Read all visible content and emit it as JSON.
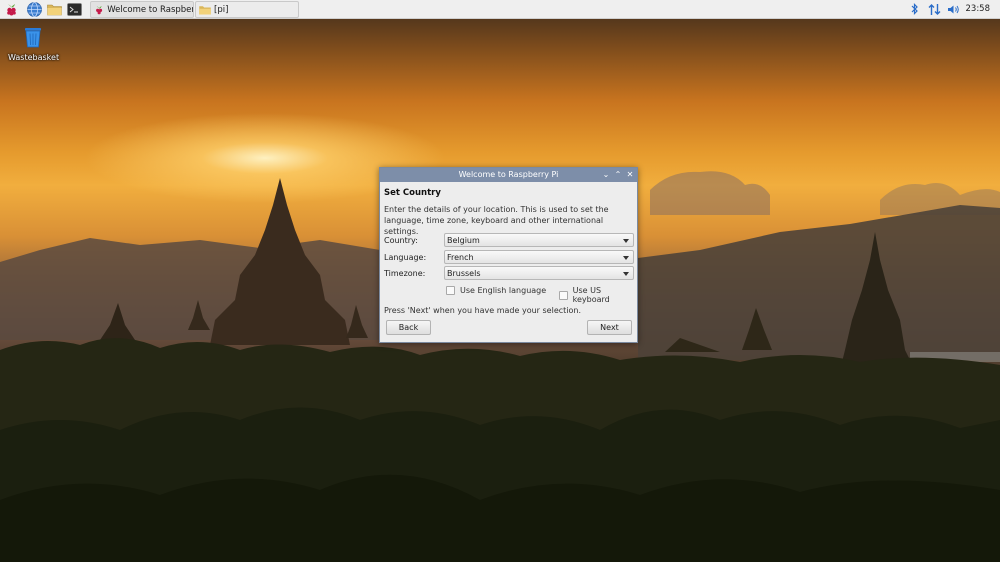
{
  "taskbar": {
    "tasks": [
      {
        "label": "Welcome to Raspberr..."
      },
      {
        "label": "[pi]"
      }
    ],
    "clock": "23:58",
    "icons": [
      "raspberry-menu-icon",
      "web-browser-icon",
      "file-manager-icon",
      "terminal-icon",
      "bluetooth-icon",
      "network-icon",
      "volume-icon"
    ]
  },
  "desktop": {
    "trash_label": "Wastebasket"
  },
  "dialog": {
    "title": "Welcome to Raspberry Pi",
    "heading": "Set Country",
    "description": "Enter the details of your location. This is used to set the language, time zone, keyboard and other international settings.",
    "fields": {
      "country": {
        "label": "Country:",
        "value": "Belgium"
      },
      "language": {
        "label": "Language:",
        "value": "French"
      },
      "timezone": {
        "label": "Timezone:",
        "value": "Brussels"
      }
    },
    "checkboxes": {
      "english": {
        "label": "Use English language",
        "checked": false
      },
      "us_keyboard": {
        "label": "Use US keyboard",
        "checked": false
      }
    },
    "hint": "Press 'Next' when you have made your selection.",
    "back_label": "Back",
    "next_label": "Next"
  },
  "colors": {
    "titlebar": "#7d8ea9",
    "dialog_bg": "#ededed",
    "raspberry": "#c51a4a"
  }
}
